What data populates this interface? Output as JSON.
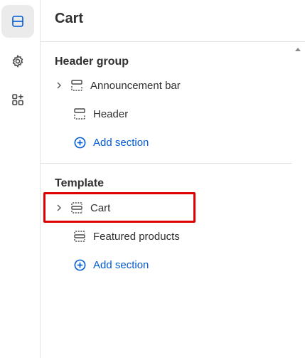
{
  "rail": {
    "items": [
      {
        "icon": "sections-icon",
        "active": true
      },
      {
        "icon": "gear-icon",
        "active": false
      },
      {
        "icon": "apps-add-icon",
        "active": false
      }
    ]
  },
  "panel": {
    "title": "Cart"
  },
  "header_group": {
    "title": "Header group",
    "items": [
      {
        "label": "Announcement bar",
        "icon": "section-icon",
        "expandable": true
      },
      {
        "label": "Header",
        "icon": "section-icon",
        "expandable": false
      }
    ],
    "add_label": "Add section"
  },
  "template": {
    "title": "Template",
    "items": [
      {
        "label": "Cart",
        "icon": "section-icon",
        "expandable": true,
        "highlighted": true
      },
      {
        "label": "Featured products",
        "icon": "section-icon",
        "expandable": false
      }
    ],
    "add_label": "Add section"
  },
  "colors": {
    "accent": "#005bd3",
    "highlight": "#e00000",
    "text": "#303030"
  }
}
